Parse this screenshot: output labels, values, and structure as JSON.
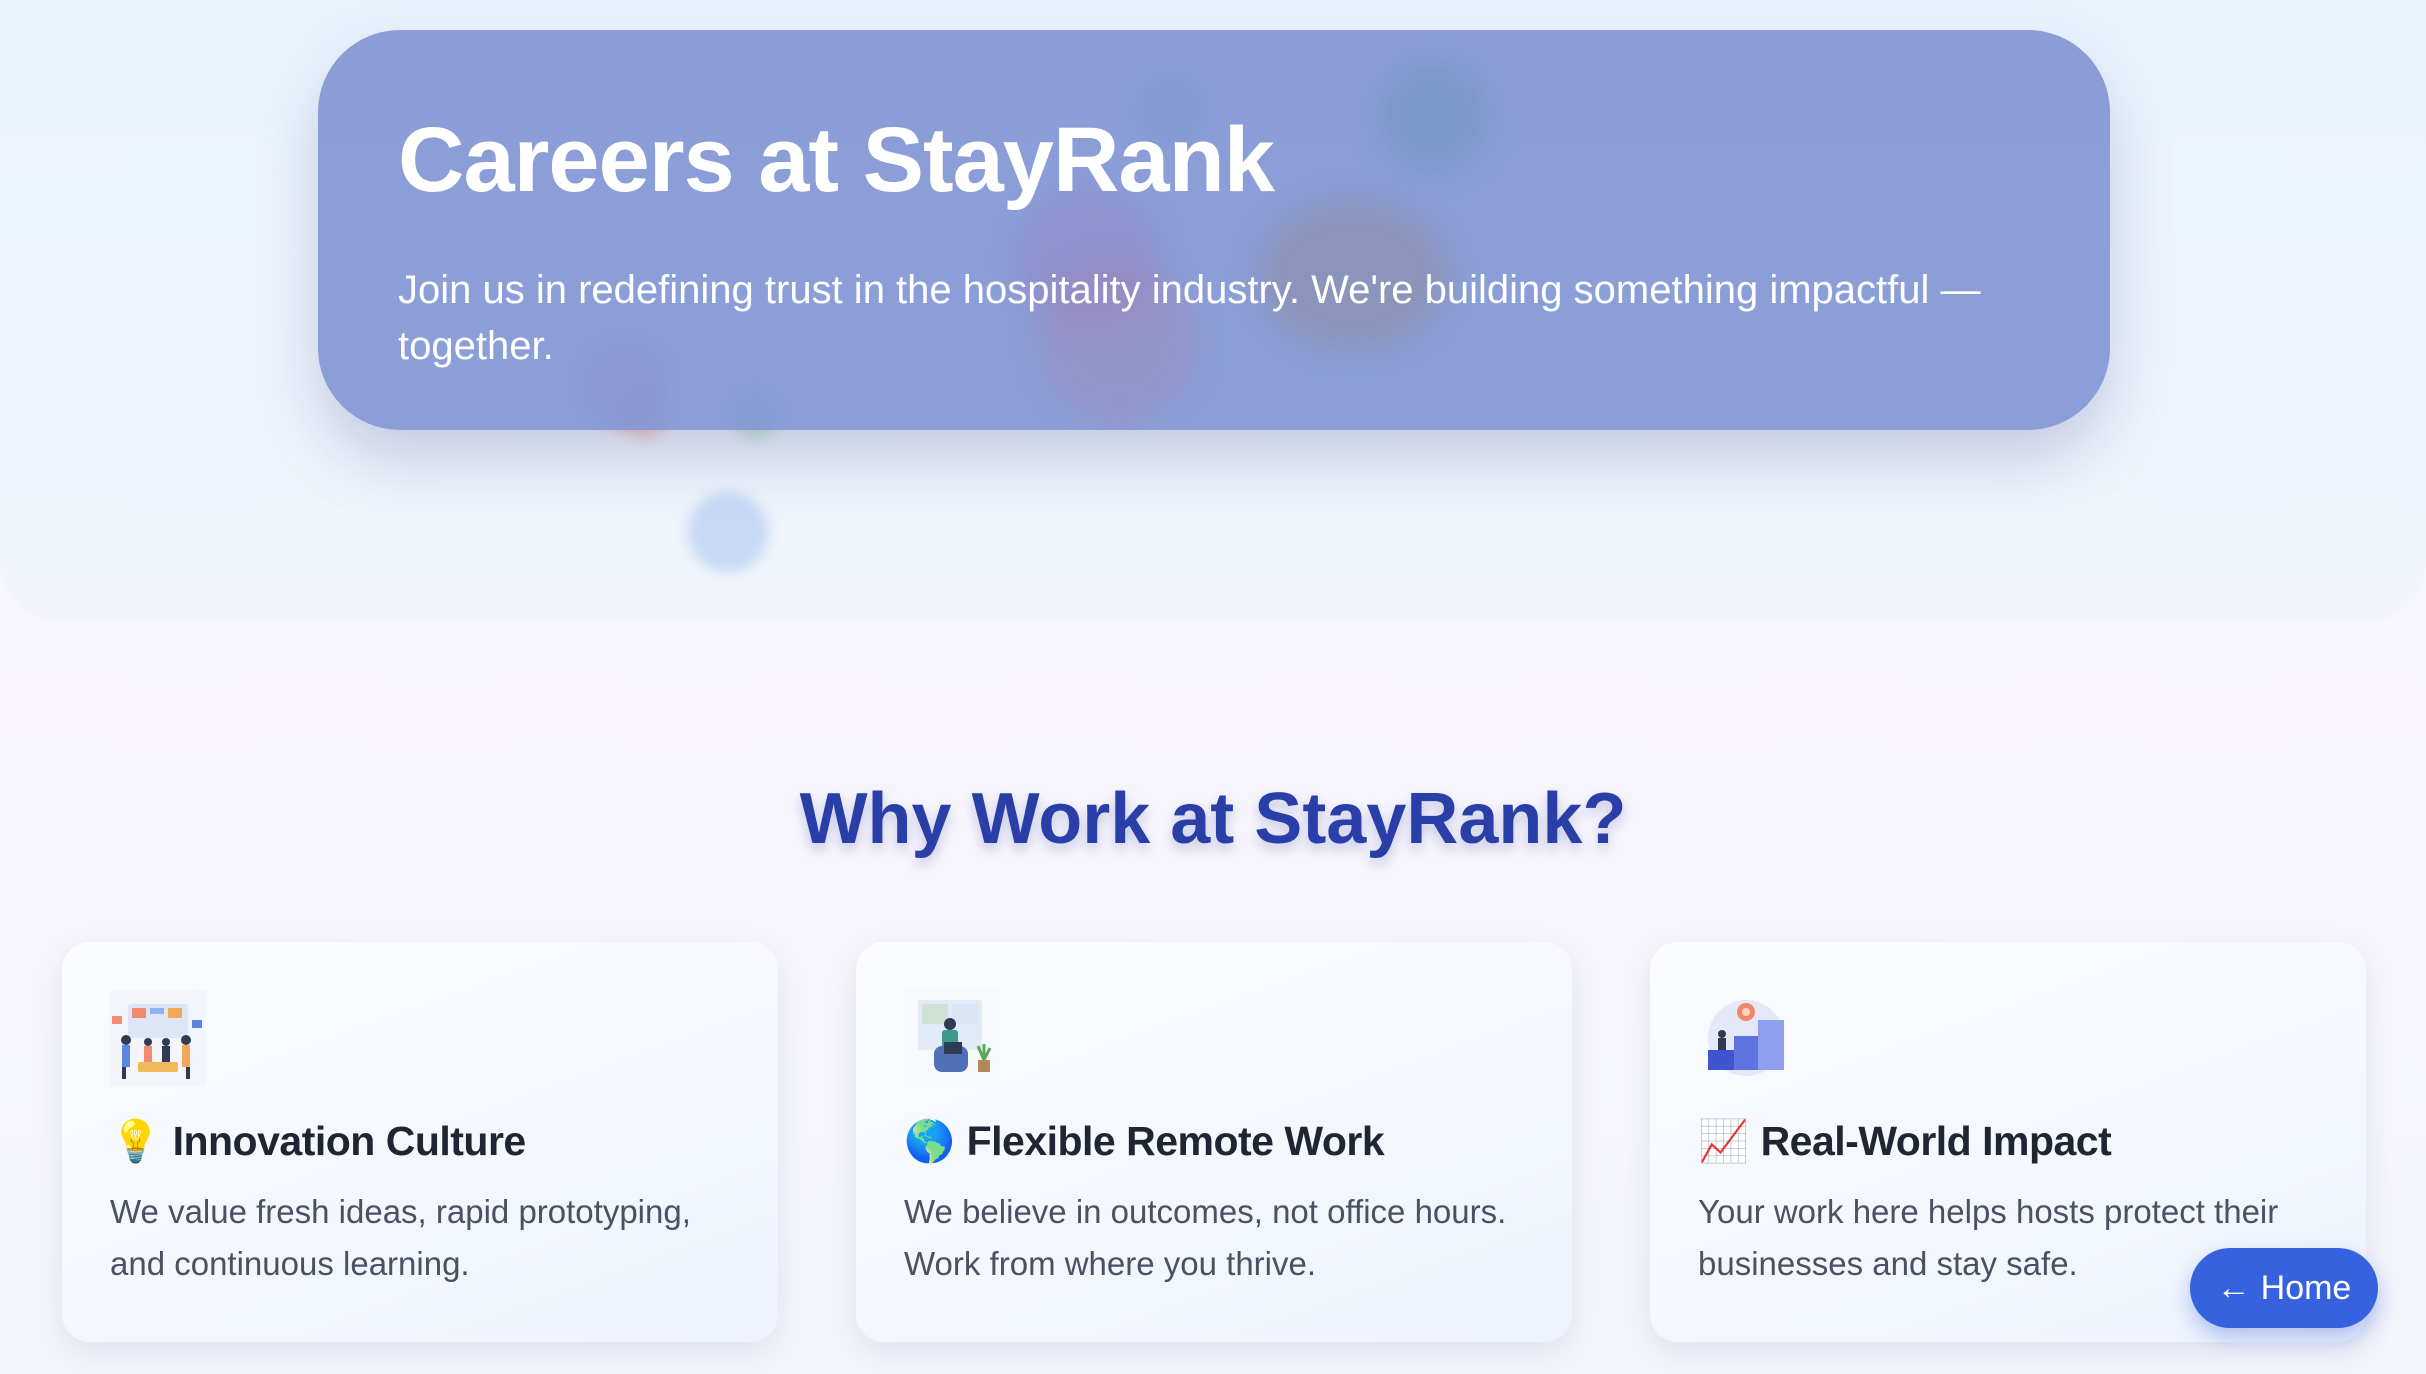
{
  "hero": {
    "title": "Careers at StayRank",
    "subtitle": "Join us in redefining trust in the hospitality industry. We're building something impactful — together."
  },
  "section": {
    "title": "Why Work at StayRank?"
  },
  "cards": [
    {
      "illustration": "team-collaboration-illustration",
      "emoji": "💡",
      "title": "Innovation Culture",
      "description": "We value fresh ideas, rapid prototyping, and continuous learning."
    },
    {
      "illustration": "remote-worker-illustration",
      "emoji": "🌎",
      "title": "Flexible Remote Work",
      "description": "We believe in outcomes, not office hours. Work from where you thrive."
    },
    {
      "illustration": "growth-steps-illustration",
      "emoji": "📈",
      "title": "Real-World Impact",
      "description": "Your work here helps hosts protect their businesses and stay safe."
    }
  ],
  "nav": {
    "home_arrow": "←",
    "home_label": "Home"
  },
  "colors": {
    "hero_card": "#8296d4",
    "section_title": "#2a3ea8",
    "home_button": "#3662e0"
  }
}
